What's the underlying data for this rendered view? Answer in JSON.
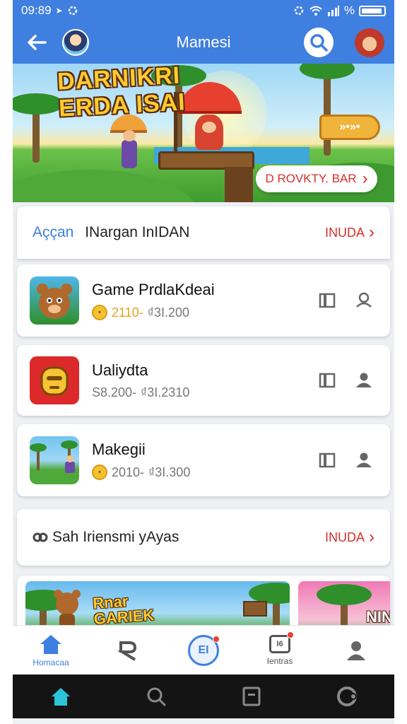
{
  "status_bar": {
    "time": "09:89",
    "signal_text": "%"
  },
  "app_bar": {
    "title": "Mamesi"
  },
  "banner": {
    "logo_text_line1": "DARNIKRI",
    "logo_text_line2": "ERDA ISAI",
    "sign_text": "»•»•",
    "cta_label": "D ROVKTY. BAR"
  },
  "featured_section": {
    "accent_label": "Aççan",
    "title": "INargan InIDAN",
    "more_label": "INUDA"
  },
  "apps": [
    {
      "name": "Game PrdlaKdeai",
      "price_primary": "2110-",
      "price_secondary": "₫3I.200",
      "icon": "bear-game-icon",
      "coin_symbol": "•"
    },
    {
      "name": "Ualiydta",
      "price_primary": "S8.200-",
      "price_secondary": "₫3I.2310",
      "icon": "red-robot-icon"
    },
    {
      "name": "Makegii",
      "price_primary": "2010-",
      "price_secondary": "₫3I.300",
      "icon": "jungle-scene-icon",
      "coin_symbol": "•"
    }
  ],
  "second_section": {
    "title": "Sah Iriensmi yAyas",
    "more_label": "INUDA"
  },
  "promos": {
    "promo1_text_line1": "Rnar",
    "promo1_text_line2": "GARIEK",
    "promo2_text": "NIN"
  },
  "bottom_nav": [
    {
      "label": "Homacaa",
      "icon": "home-icon"
    },
    {
      "label": "",
      "icon": "rank-icon"
    },
    {
      "label": "",
      "icon": "badge-shield-icon",
      "inner_text": "EI"
    },
    {
      "label": "Ientras",
      "icon": "ticket-icon",
      "inner_text": "I6"
    },
    {
      "label": "",
      "icon": "person-icon"
    }
  ],
  "colors": {
    "primary": "#3f7fe0",
    "accent_red": "#d6302a",
    "coin_gold": "#f3c232",
    "system_bar": "#141414",
    "home_active": "#2bc4d9"
  }
}
